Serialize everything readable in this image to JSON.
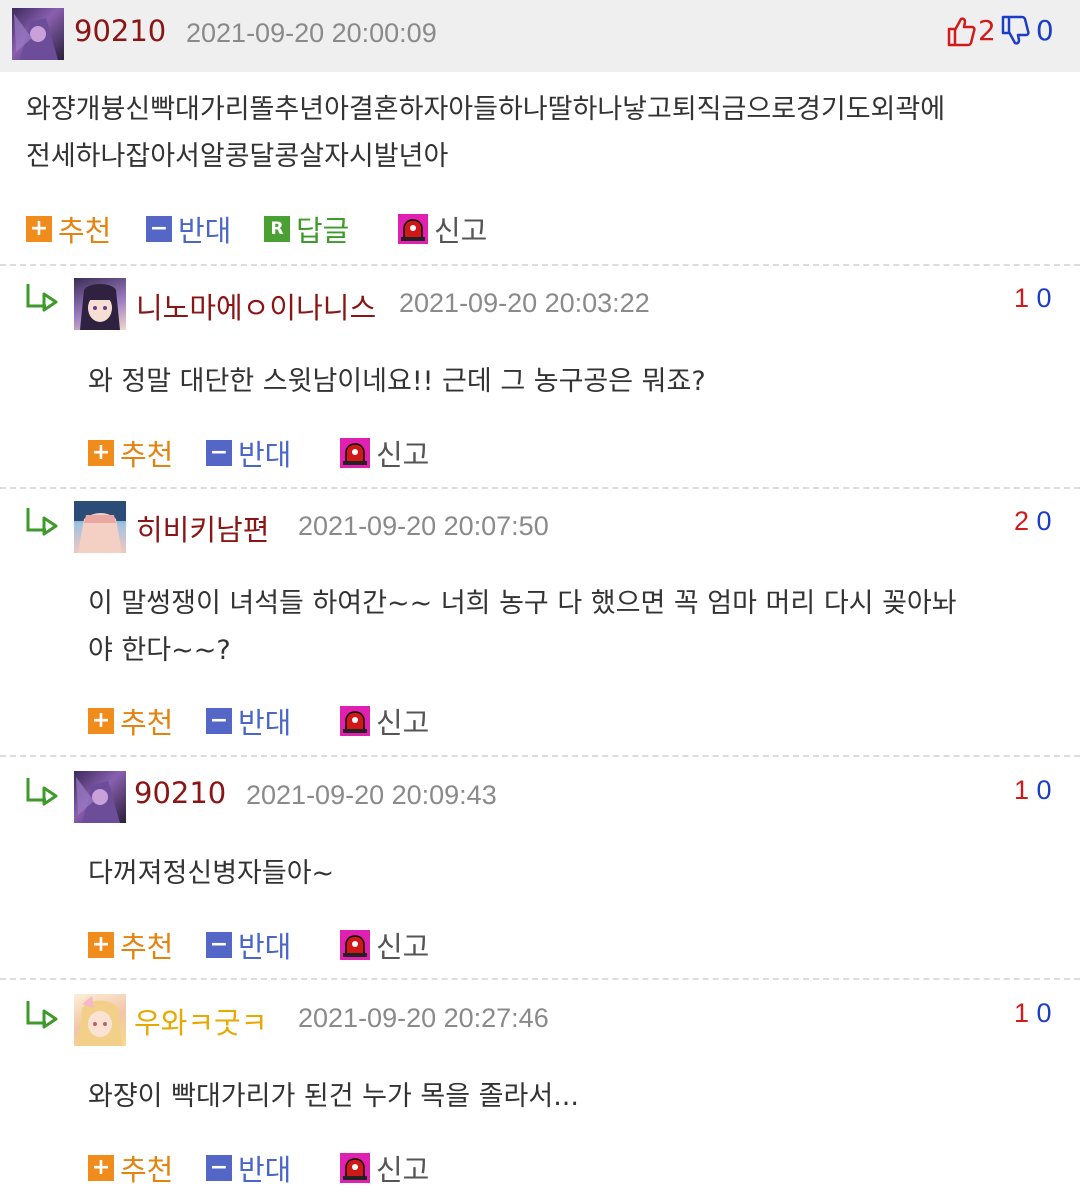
{
  "colors": {
    "up": "#d21a1a",
    "down": "#1b3dc7",
    "plus": "#f08c1c",
    "minus": "#5467c7",
    "reply": "#4aa033",
    "nick_default": "#8b1515",
    "nick_yellow": "#e8a800",
    "header_bg": "#efefef"
  },
  "post": {
    "nickname": "90210",
    "date": "2021-09-20 20:00:09",
    "up_count": "2",
    "down_count": "0",
    "body_lines": [
      "와쟝개븅신빡대가리똘추년아결혼하자아들하나딸하나낳고퇴직금으로경기도외곽에",
      "전세하나잡아서알콩달콩살자시발년아"
    ],
    "actions": {
      "recommend": "추천",
      "oppose": "반대",
      "reply": "답글",
      "report": "신고"
    },
    "icons": {
      "up": "thumbs-up-icon",
      "down": "thumbs-down-icon",
      "reply_badge": "R"
    }
  },
  "comments": [
    {
      "nickname": "니노마에ㅇ이나니스",
      "date": "2021-09-20 20:03:22",
      "up": "1",
      "down": "0",
      "lines": [
        "와 정말 대단한 스윗남이네요!! 근데 그 농구공은 뭐죠?"
      ]
    },
    {
      "nickname": "히비키남편",
      "date": "2021-09-20 20:07:50",
      "up": "2",
      "down": "0",
      "lines": [
        "이 말썽쟁이 녀석들 하여간~~ 너희 농구 다 했으면 꼭 엄마 머리 다시 꽂아놔",
        "야 한다~~?"
      ]
    },
    {
      "nickname": "90210",
      "date": "2021-09-20 20:09:43",
      "up": "1",
      "down": "0",
      "lines": [
        "다꺼져정신병자들아~"
      ]
    },
    {
      "nickname": "우와ㅋ굿ㅋ",
      "date": "2021-09-20 20:27:46",
      "up": "1",
      "down": "0",
      "lines": [
        "와쟝이 빡대가리가 된건 누가 목을 졸라서..."
      ]
    }
  ],
  "comment_actions": {
    "recommend": "추천",
    "oppose": "반대",
    "report": "신고"
  }
}
